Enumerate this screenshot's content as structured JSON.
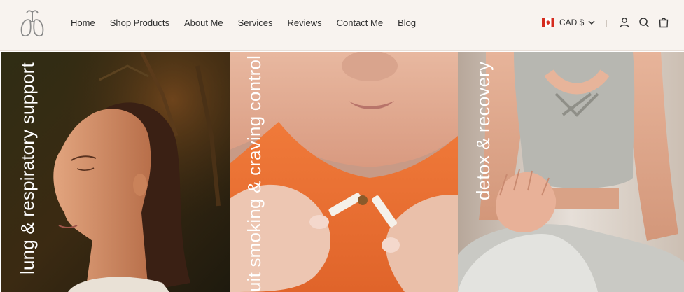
{
  "nav": {
    "items": [
      {
        "label": "Home"
      },
      {
        "label": "Shop Products"
      },
      {
        "label": "About Me"
      },
      {
        "label": "Services"
      },
      {
        "label": "Reviews"
      },
      {
        "label": "Contact Me"
      },
      {
        "label": "Blog"
      }
    ]
  },
  "header": {
    "logo_icon": "lungs-icon",
    "currency": {
      "label": "CAD $",
      "flag_icon": "canada-flag-icon"
    },
    "icons": [
      "account-icon",
      "search-icon",
      "cart-icon"
    ]
  },
  "tiles": [
    {
      "label": "lung & respiratory support"
    },
    {
      "label": "uit smoking & craving control"
    },
    {
      "label": "detox & recovery"
    }
  ],
  "colors": {
    "header_bg": "#f8f3ef",
    "nav_text": "#2f2f2f",
    "tile_text": "#ffffff",
    "flag_red": "#d52b1e"
  }
}
